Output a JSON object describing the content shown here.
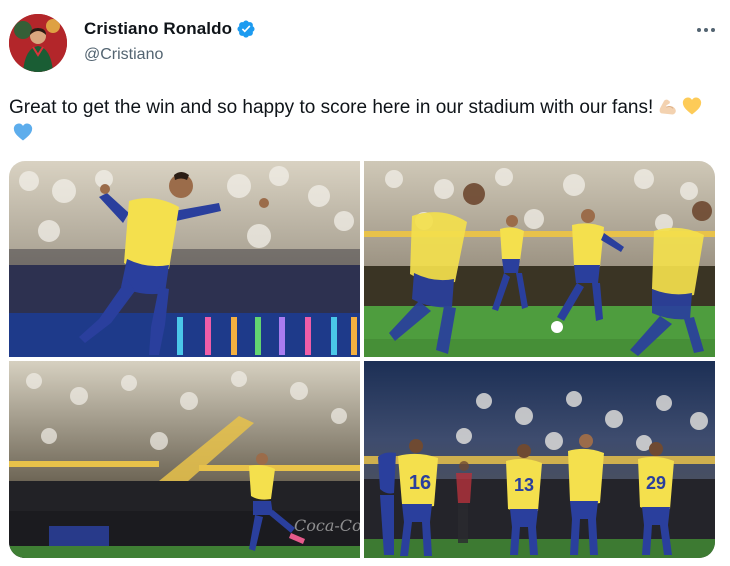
{
  "author": {
    "display_name": "Cristiano Ronaldo",
    "handle": "@Cristiano",
    "verified_icon": "verified-badge-icon",
    "verified_color": "#1d9bf0"
  },
  "tweet": {
    "text": "Great to get the win and so happy to score here in our stadium with our fans!",
    "emojis": [
      "flexed-biceps-emoji",
      "yellow-heart-emoji",
      "blue-heart-emoji"
    ]
  },
  "media": {
    "photos": [
      {
        "subject": "player celebrating"
      },
      {
        "subject": "players on pitch with ball"
      },
      {
        "subject": "player running near stands"
      },
      {
        "subject": "team walking together",
        "jersey_numbers": [
          "16",
          "13",
          "29"
        ]
      }
    ],
    "photo_4_numbers": {
      "left": "16",
      "center": "13",
      "right": "29"
    }
  },
  "colors": {
    "text_primary": "#0f1419",
    "text_secondary": "#536471",
    "accent": "#1d9bf0",
    "kit_yellow": "#f4e04d",
    "kit_blue": "#2a3f9d"
  }
}
